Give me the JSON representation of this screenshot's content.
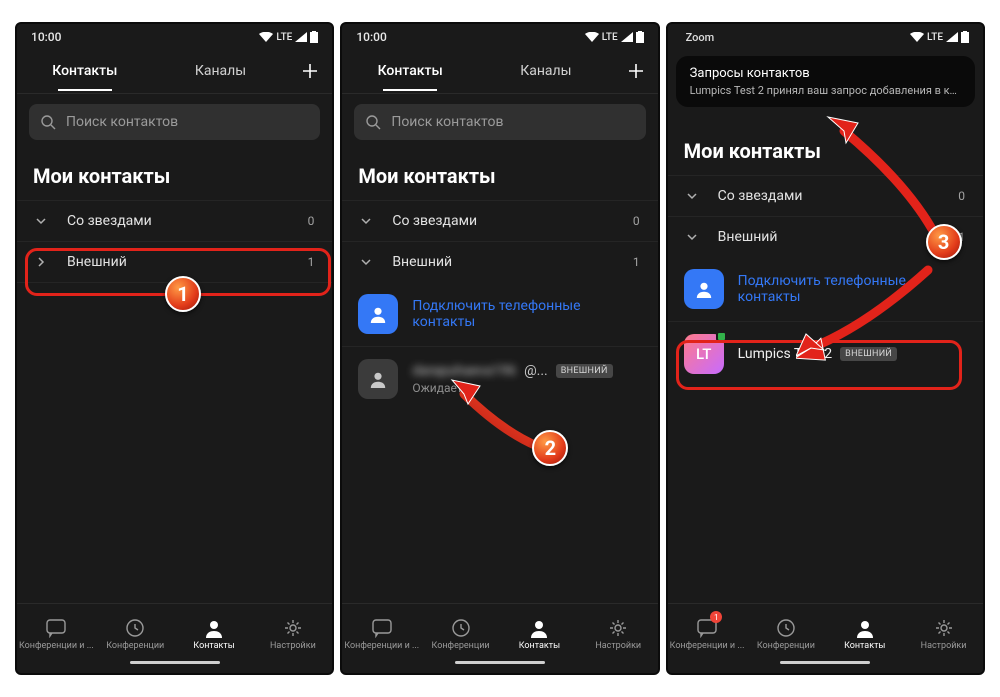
{
  "status": {
    "time": "10:00",
    "lte": "LTE",
    "zoom_app": "Zoom"
  },
  "tabs": {
    "contacts": "Контакты",
    "channels": "Каналы"
  },
  "search": {
    "placeholder": "Поиск контактов"
  },
  "section_title": "Мои контакты",
  "groups": {
    "starred": {
      "label": "Со звездами",
      "count": "0"
    },
    "external": {
      "label": "Внешний",
      "count": "1"
    }
  },
  "connect_label": "Подключить телефонные контакты",
  "pending_contact": {
    "name_masked": "darapuhaeva196",
    "at": "@...",
    "status": "Ожидает...",
    "badge": "ВНЕШНИЙ"
  },
  "accepted_contact": {
    "initials": "LT",
    "name": "Lumpics Test 2",
    "badge": "ВНЕШНИЙ"
  },
  "notification": {
    "title": "Запросы контактов",
    "body": "Lumpics Test 2 принял ваш запрос добавления в ко..."
  },
  "nav": {
    "meetings_chat": "Конференции и ...",
    "meetings": "Конференции",
    "contacts": "Контакты",
    "settings": "Настройки",
    "badge_count": "1"
  },
  "markers": {
    "m1": "1",
    "m2": "2",
    "m3": "3"
  }
}
